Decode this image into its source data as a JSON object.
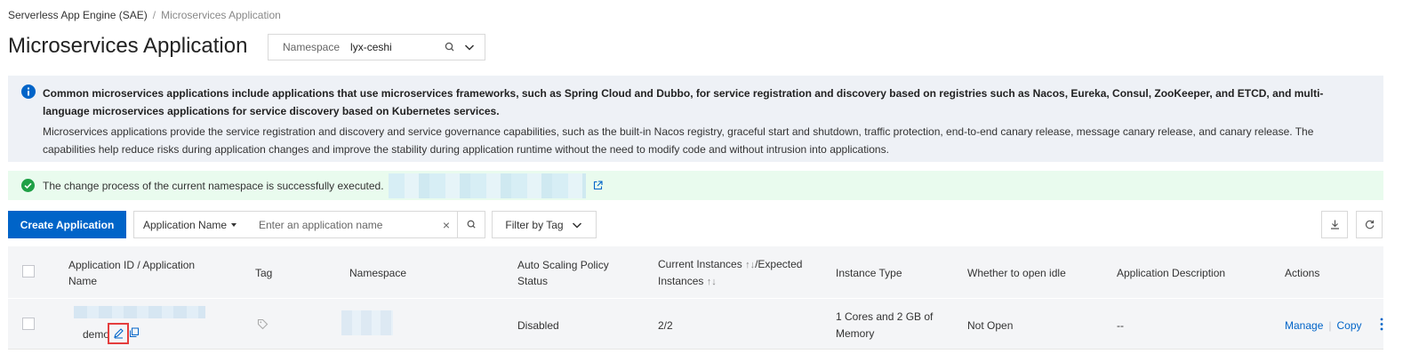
{
  "breadcrumb": {
    "root": "Serverless App Engine (SAE)",
    "sep": "/",
    "current": "Microservices Application"
  },
  "page_title": "Microservices Application",
  "namespace": {
    "label": "Namespace",
    "value": "lyx-ceshi"
  },
  "info": {
    "bold": "Common microservices applications include applications that use microservices frameworks, such as Spring Cloud and Dubbo, for service registration and discovery based on registries such as Nacos, Eureka, Consul, ZooKeeper, and ETCD, and multi-language microservices applications for service discovery based on Kubernetes services.",
    "body": "Microservices applications provide the service registration and discovery and service governance capabilities, such as the built-in Nacos registry, graceful start and shutdown, traffic protection, end-to-end canary release, message canary release, and canary release. The capabilities help reduce risks during application changes and improve the stability during application runtime without the need to modify code and without intrusion into applications."
  },
  "success_msg": "The change process of the current namespace is successfully executed.",
  "toolbar": {
    "create": "Create Application",
    "search_field": "Application Name",
    "search_placeholder": "Enter an application name",
    "clear": "×",
    "filter": "Filter by Tag"
  },
  "table": {
    "headers": {
      "app_l1": "Application ID / Application",
      "app_l2": "Name",
      "tag": "Tag",
      "namespace": "Namespace",
      "scaling_l1": "Auto Scaling Policy",
      "scaling_l2": "Status",
      "inst_l1": "Current Instances",
      "inst_l1b": "/Expected",
      "inst_l2": "Instances",
      "type": "Instance Type",
      "idle": "Whether to open idle",
      "desc": "Application Description",
      "actions": "Actions",
      "sort_icon": "↑↓"
    },
    "rows": [
      {
        "name": "demo",
        "scaling": "Disabled",
        "instances": "2/2",
        "type_l1": "1 Cores and 2 GB of",
        "type_l2": "Memory",
        "idle": "Not Open",
        "desc": "--",
        "manage": "Manage",
        "copy": "Copy"
      }
    ]
  },
  "colors": {
    "primary": "#0064c8",
    "info_bg": "#eef1f6",
    "success_bg": "#e9fbee",
    "success": "#1fa046",
    "highlight": "#e43d3d"
  }
}
